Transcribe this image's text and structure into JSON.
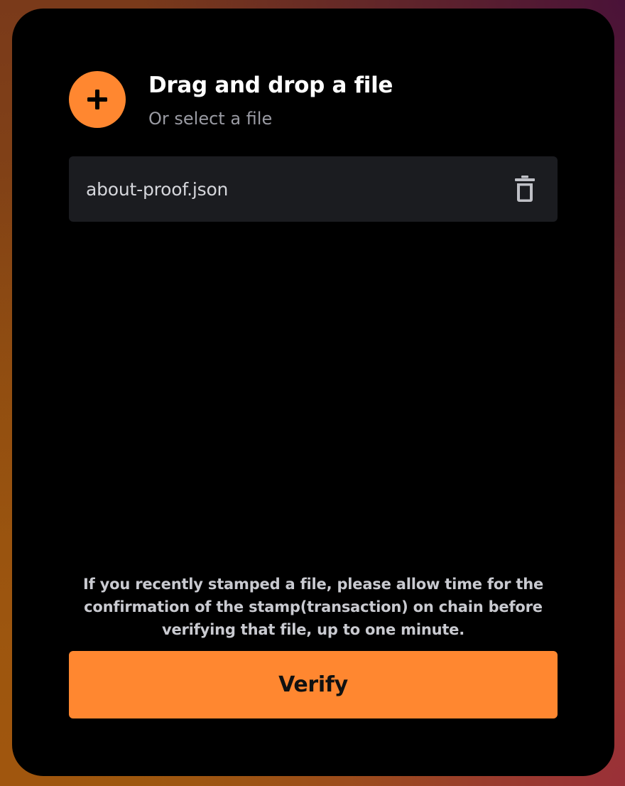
{
  "dropzone": {
    "title": "Drag and drop a file",
    "subtitle": "Or select a file",
    "icon": "plus-icon"
  },
  "files": [
    {
      "name": "about-proof.json",
      "delete_icon": "trash-icon"
    }
  ],
  "notice": "If you recently stamped a file, please allow time for the confirmation of the stamp(transaction) on chain before verifying that file, up to one minute.",
  "verify_button": {
    "label": "Verify"
  },
  "colors": {
    "accent": "#ff8730",
    "card_bg": "#000000",
    "file_row_bg": "#1b1c20",
    "subtitle": "#9a9ba3"
  }
}
